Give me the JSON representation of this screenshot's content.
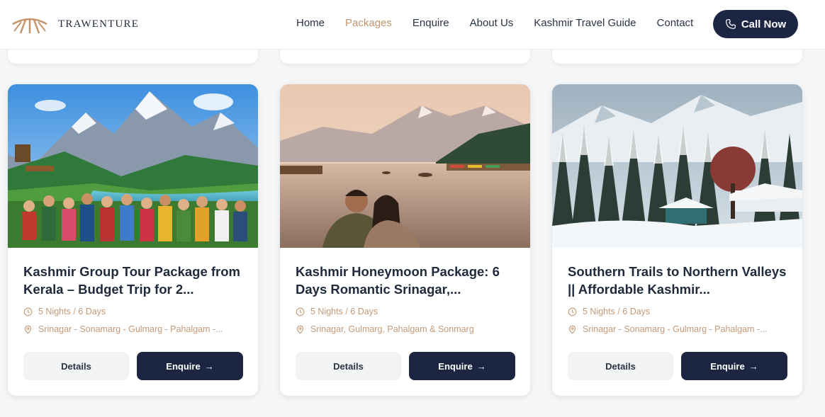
{
  "brand": {
    "name": "TRAWENTURE"
  },
  "nav": {
    "items": [
      {
        "label": "Home",
        "active": false
      },
      {
        "label": "Packages",
        "active": true
      },
      {
        "label": "Enquire",
        "active": false
      },
      {
        "label": "About Us",
        "active": false
      },
      {
        "label": "Kashmir Travel Guide",
        "active": false
      },
      {
        "label": "Contact",
        "active": false
      }
    ],
    "call_label": "Call Now"
  },
  "colors": {
    "navy": "#1c2541",
    "accent": "#c4956b",
    "meta": "#c39a78"
  },
  "cards": [
    {
      "title": "Kashmir Group Tour Package from Kerala – Budget Trip for 2...",
      "duration": "5 Nights / 6 Days",
      "route": "Srinagar - Sonamarg - Gulmarg - Pahalgam -...",
      "details_label": "Details",
      "enquire_label": "Enquire",
      "image": "group-tourists-mountain-valley"
    },
    {
      "title": "Kashmir Honeymoon Package: 6 Days Romantic Srinagar,...",
      "duration": "5 Nights / 6 Days",
      "route": "Srinagar, Gulmarg, Pahalgam & Sonmarg",
      "details_label": "Details",
      "enquire_label": "Enquire",
      "image": "couple-dal-lake-sunrise"
    },
    {
      "title": "Southern Trails to Northern Valleys || Affordable Kashmir...",
      "duration": "5 Nights / 6 Days",
      "route": "Srinagar - Sonamarg - Gulmarg - Pahalgam -...",
      "details_label": "Details",
      "enquire_label": "Enquire",
      "image": "snowy-forest-cottage"
    }
  ]
}
